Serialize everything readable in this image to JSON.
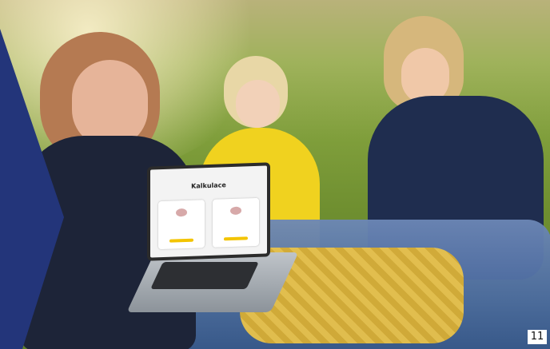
{
  "screen": {
    "title": "Kalkulace"
  },
  "page": {
    "number": "11"
  }
}
